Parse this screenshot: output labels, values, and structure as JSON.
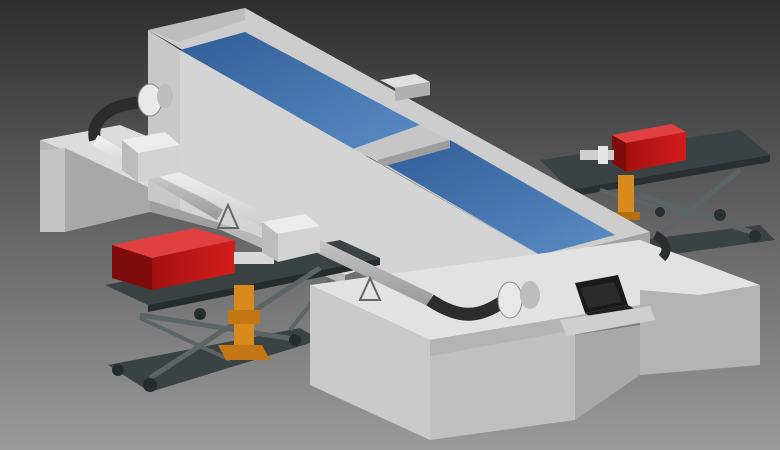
{
  "scene": {
    "colors": {
      "background_top": "#2e2e2e",
      "background_bottom": "#9a9a9a",
      "concrete_light": "#dcdcdc",
      "concrete_mid": "#c4c4c4",
      "concrete_dark": "#9e9e9e",
      "water": "#3e6fa8",
      "water_light": "#5b8cc4",
      "motor_red": "#c41616",
      "motor_red_dark": "#7e0c0c",
      "jack_orange": "#d98a1c",
      "frame_dark": "#3b4244",
      "frame_plate": "#4a5355",
      "pipe": "#d0d0d0",
      "pipe_dark": "#2c2c2c",
      "laptop": "#1a1a1a"
    },
    "components": [
      "water-channel-tank",
      "pipe-loop",
      "left-motor-unit",
      "right-motor-unit",
      "scissor-lift-left",
      "scissor-lift-right",
      "laptop"
    ]
  }
}
